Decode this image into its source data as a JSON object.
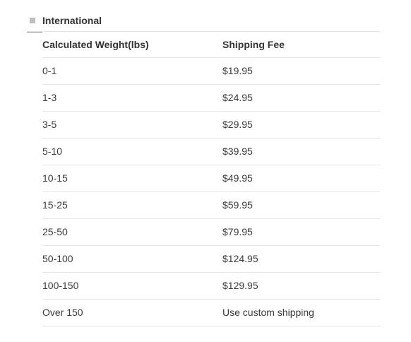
{
  "section": {
    "title": "International"
  },
  "table": {
    "headers": {
      "weight": "Calculated Weight(lbs)",
      "fee": "Shipping Fee"
    },
    "rows": [
      {
        "weight": "0-1",
        "fee": "$19.95"
      },
      {
        "weight": "1-3",
        "fee": "$24.95"
      },
      {
        "weight": "3-5",
        "fee": "$29.95"
      },
      {
        "weight": "5-10",
        "fee": "$39.95"
      },
      {
        "weight": "10-15",
        "fee": "$49.95"
      },
      {
        "weight": "15-25",
        "fee": "$59.95"
      },
      {
        "weight": "25-50",
        "fee": "$79.95"
      },
      {
        "weight": "50-100",
        "fee": "$124.95"
      },
      {
        "weight": "100-150",
        "fee": "$129.95"
      },
      {
        "weight": "Over 150",
        "fee": "Use custom shipping"
      }
    ]
  },
  "colors": {
    "text": "#3a3a3a",
    "heading": "#333333",
    "divider": "#e6e6e6",
    "bullet": "#bdbdbd"
  }
}
